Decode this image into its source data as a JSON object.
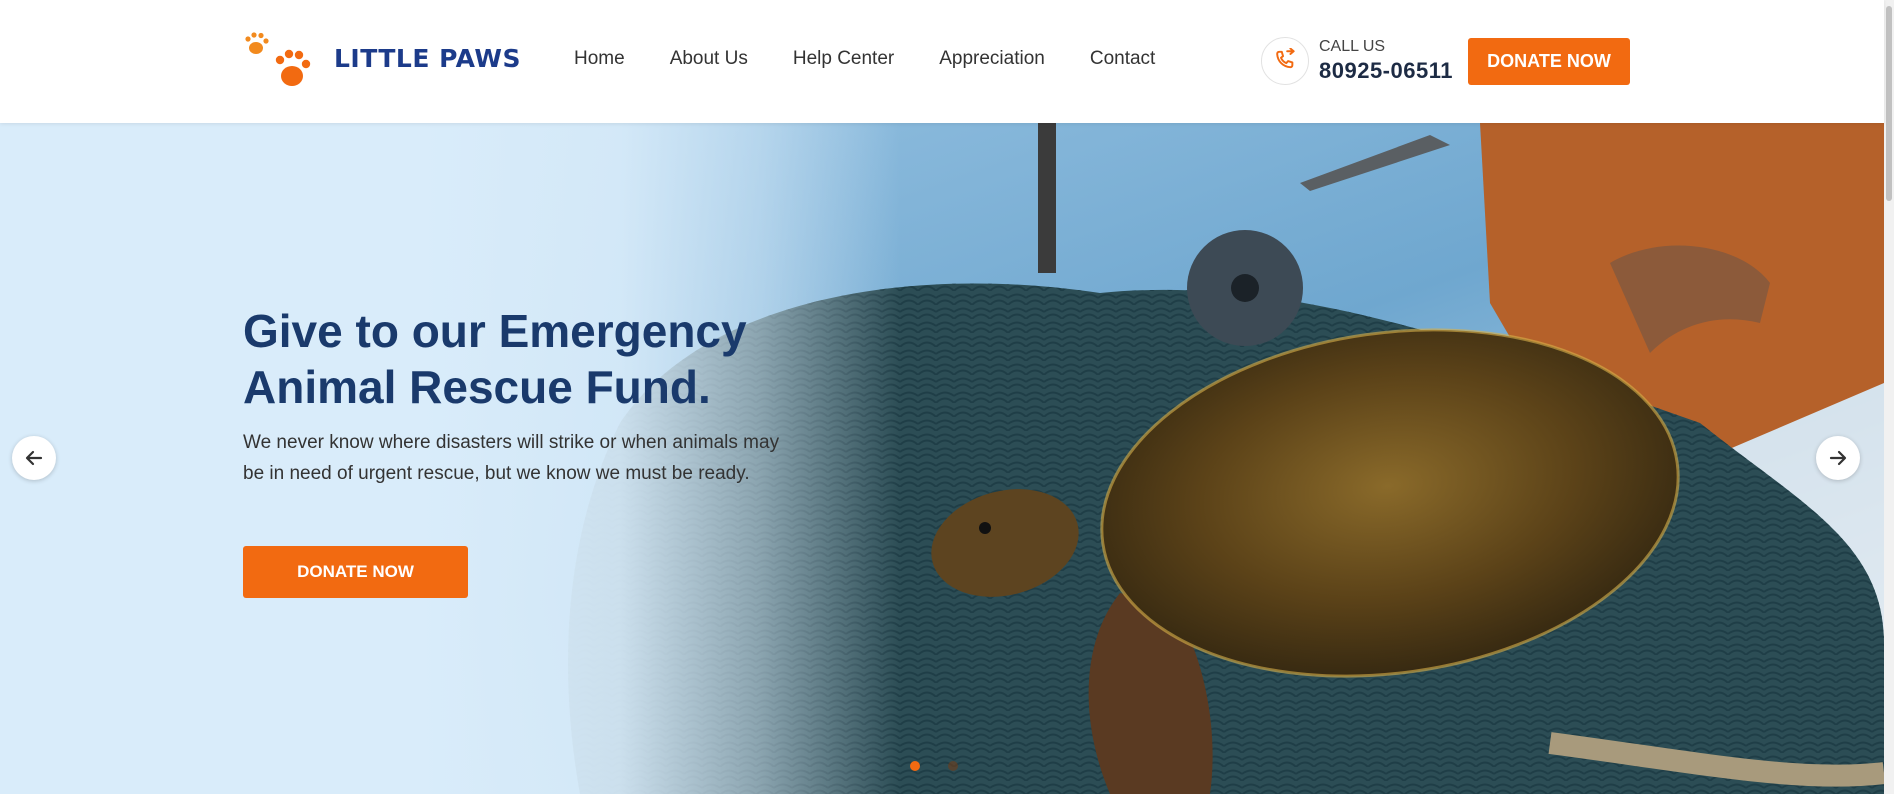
{
  "brand": {
    "name": "LITTLE PAWS",
    "logo_icon": "paw-prints-icon",
    "accent_color": "#f26a11",
    "primary_color": "#1c3b8a"
  },
  "nav": {
    "items": [
      {
        "label": "Home"
      },
      {
        "label": "About Us"
      },
      {
        "label": "Help Center"
      },
      {
        "label": "Appreciation"
      },
      {
        "label": "Contact"
      }
    ]
  },
  "call": {
    "label": "CALL US",
    "number": "80925-06511",
    "icon": "phone-call-icon"
  },
  "header_cta": {
    "label": "DONATE NOW"
  },
  "hero": {
    "title": "Give to our Emergency Animal Rescue Fund.",
    "text": "We never know where disasters will strike or when animals may be in need of urgent rescue, but we know we must be ready.",
    "cta": "DONATE NOW",
    "image": "sea turtle entangled in fishing nets",
    "prev_icon": "arrow-left-icon",
    "next_icon": "arrow-right-icon",
    "slides_total": 2,
    "slide_active": 1
  }
}
